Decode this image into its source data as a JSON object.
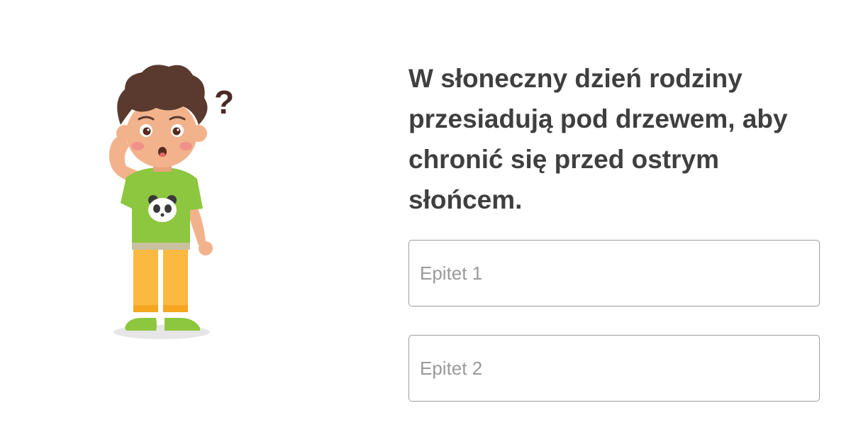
{
  "question": {
    "text": "W słoneczny dzień rodziny przesiadują pod drzewem, aby chronić się przed ostrym słońcem."
  },
  "fields": [
    {
      "placeholder": "Epitet 1",
      "value": ""
    },
    {
      "placeholder": "Epitet 2",
      "value": ""
    }
  ],
  "illustration": {
    "icon": "confused-boy-icon",
    "question_mark": "?",
    "colors": {
      "hair": "#5a3a2e",
      "skin": "#f2b38c",
      "shirt": "#8dc63f",
      "pants": "#fbb940",
      "shoes": "#8dc63f"
    }
  }
}
